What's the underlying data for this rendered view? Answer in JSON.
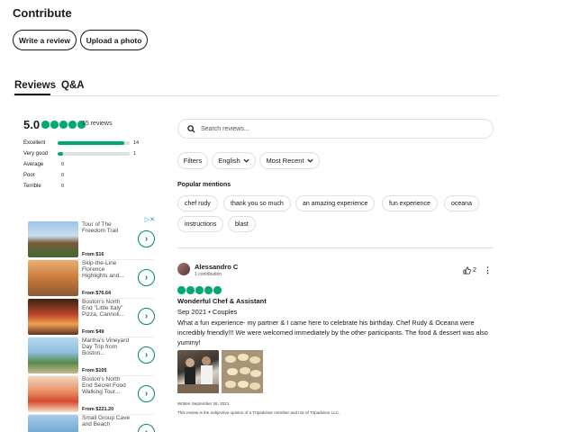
{
  "contribute": {
    "title": "Contribute",
    "write_review": "Write a review",
    "upload_photo": "Upload a photo"
  },
  "tabs": {
    "reviews": "Reviews",
    "qa": "Q&A"
  },
  "summary": {
    "rating": "5.0",
    "review_count": "15 reviews",
    "rating_fraction": 1.0,
    "distribution": [
      {
        "label": "Excellent",
        "count": "14",
        "fraction": 0.93
      },
      {
        "label": "Very good",
        "count": "1",
        "fraction": 0.07
      },
      {
        "label": "Average",
        "count": "0",
        "fraction": 0
      },
      {
        "label": "Poor",
        "count": "0",
        "fraction": 0
      },
      {
        "label": "Terrible",
        "count": "0",
        "fraction": 0
      }
    ]
  },
  "search": {
    "placeholder": "Search reviews..."
  },
  "filters": {
    "filters": "Filters",
    "language": "English",
    "sort": "Most Recent"
  },
  "mentions": {
    "title": "Popular mentions",
    "items": [
      "chef rudy",
      "thank you so much",
      "an amazing experience",
      "fun experience",
      "oceana",
      "instructions",
      "blast"
    ]
  },
  "ads": {
    "items": [
      {
        "title": "Tour of The Freedom Trail",
        "price": "From $16"
      },
      {
        "title": "Skip-the-Line Florence Highlights and...",
        "price": "From $76.64"
      },
      {
        "title": "Boston's North End \"Little Italy\" Pizza, Cannoli...",
        "price": "From $49"
      },
      {
        "title": "Martha's Vineyard Day Trip from Boston...",
        "price": "From $105"
      },
      {
        "title": "Boston's North End Secret Food Walking Tour...",
        "price": "From $221.20"
      },
      {
        "title": "Small Group Cave and Beach",
        "price": ""
      }
    ]
  },
  "review": {
    "name": "Alessandro C",
    "contributions": "1 contribution",
    "helpful_count": "2",
    "rating_fraction": 1.0,
    "title": "Wonderful Chef & Assistant",
    "meta": "Sep 2021 • Couples",
    "body": "What a fun experience- my partner & I came here to celebrate his birthday. Chef Rudy & Oceana were incredibly friendly!!! We were welcomed immediately by the other participants. The food & dessert was also yummy!",
    "written": "Written September 26, 2021",
    "disclaimer": "This review is the subjective opinion of a Tripadvisor member and not of Tripadvisor LLC."
  }
}
